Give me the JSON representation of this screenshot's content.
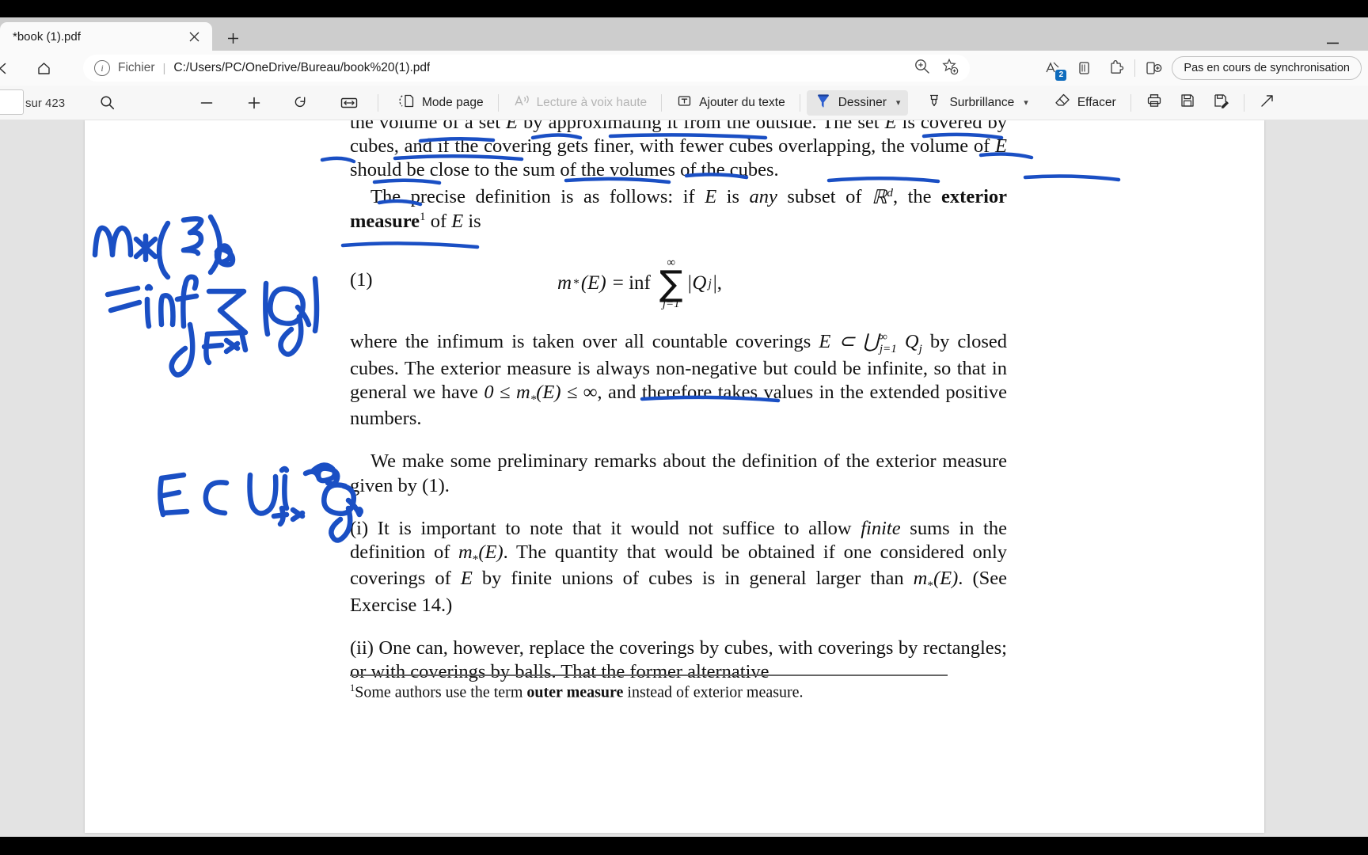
{
  "browser": {
    "tab": {
      "title": "*book (1).pdf",
      "close_icon": "close-icon"
    },
    "new_tab_label": "+",
    "minimize_label": "—",
    "nav": {
      "back_icon": "back-arrow-icon",
      "home_icon": "home-icon",
      "scheme_label": "Fichier",
      "url": "C:/Users/PC/OneDrive/Bureau/book%20(1).pdf",
      "zoom_icon": "zoom-in-icon",
      "favorite_icon": "add-favorite-icon"
    },
    "actions": {
      "translate_icon": "translate-icon",
      "translate_badge": "2",
      "collections_icon": "collections-icon",
      "extensions_icon": "extensions-icon",
      "split_screen_icon": "split-screen-icon",
      "sync_label": "Pas en cours de synchronisation"
    }
  },
  "pdf_toolbar": {
    "page_value": "",
    "page_of_label": "sur 423",
    "search_icon": "search-icon",
    "zoom_out_label": "−",
    "zoom_in_label": "+",
    "rotate_icon": "rotate-icon",
    "fit_width_icon": "fit-width-icon",
    "page_view_label": "Mode page",
    "page_view_icon": "page-view-icon",
    "read_aloud_label": "Lecture à voix haute",
    "read_aloud_icon": "read-aloud-icon",
    "add_text_label": "Ajouter du texte",
    "add_text_icon": "add-text-icon",
    "draw_label": "Dessiner",
    "draw_icon": "pen-icon",
    "highlight_label": "Surbrillance",
    "highlight_icon": "highlighter-icon",
    "erase_label": "Effacer",
    "erase_icon": "eraser-icon",
    "print_icon": "print-icon",
    "save_icon": "save-icon",
    "save_as_icon": "save-as-icon",
    "more_icon": "expand-icon",
    "active_tool": "Dessiner",
    "accent_color": "#2d5fd0",
    "active_bg": "#e6e6e6"
  },
  "document": {
    "para_top_1": "the volume of a set ",
    "para_top_1b": " by approximating it from the outside. The set ",
    "para_top_1c": " is covered by cubes, and if the covering gets finer, with fewer cubes overlapping, the volume of ",
    "para_top_1d": " should be close to the sum of the volumes of the cubes.",
    "para_2_a": "The precise definition is as follows: if ",
    "para_2_b": " is ",
    "para_2_any": "any",
    "para_2_c": " subset of ",
    "para_2_d": ", the ",
    "para_2_bold": "exterior measure",
    "para_2_fn": "1",
    "para_2_e": " of ",
    "para_2_f": " is",
    "equation": {
      "number": "(1)",
      "lhs": "m",
      "lhs_sub": "*",
      "lhs_arg": "(E)",
      "eq": "= inf",
      "sum_upper": "∞",
      "sum_glyph": "∑",
      "sum_lower": "j=1",
      "term": "|Q",
      "term_sub": "j",
      "term_end": "|,"
    },
    "para_3_a": "where the infimum is taken over all countable coverings ",
    "para_3_math": "E ⊂ ⋃",
    "para_3_sup": "∞",
    "para_3_sub": "j=1",
    "para_3_q": " Q",
    "para_3_qsub": "j",
    "para_3_b": " by closed cubes. The exterior measure is always non-negative but could be infinite, so that in general we have ",
    "para_3_ineq": "0 ≤ m",
    "para_3_ineq_sub": "*",
    "para_3_ineq_b": "(E) ≤ ∞",
    "para_3_c": ", and therefore takes values in the extended positive numbers.",
    "para_4": "We make some preliminary remarks about the definition of the exterior measure given by (1).",
    "para_5_a": "(i) It is important to note that it would not suffice to allow ",
    "para_5_fin": "finite",
    "para_5_b": " sums in the definition of ",
    "para_5_m1": "m",
    "para_5_m1s": "*",
    "para_5_m1e": "(E)",
    "para_5_c": ". The quantity that would be obtained if one considered only coverings of ",
    "para_5_E": "E",
    "para_5_d": " by finite unions of cubes is in general larger than ",
    "para_5_m2": "m",
    "para_5_m2s": "*",
    "para_5_m2e": "(E)",
    "para_5_e": ". (See Exercise 14.)",
    "para_6": "(ii) One can, however, replace the coverings by cubes, with coverings by rectangles; or with coverings by balls. That the former alternative",
    "footnote_marker": "1",
    "footnote_a": "Some authors use the term ",
    "footnote_bold": "outer measure",
    "footnote_b": " instead of exterior measure."
  },
  "annotations": {
    "ink_color": "#1a4fc4",
    "handwritten_line_1": "m*(E)",
    "handwritten_line_2": "= inf Σ(j=1 to ∞) |Qj|",
    "handwritten_line_3": "E ⊂ ⋃(j=1 to ∞) Qj ."
  }
}
